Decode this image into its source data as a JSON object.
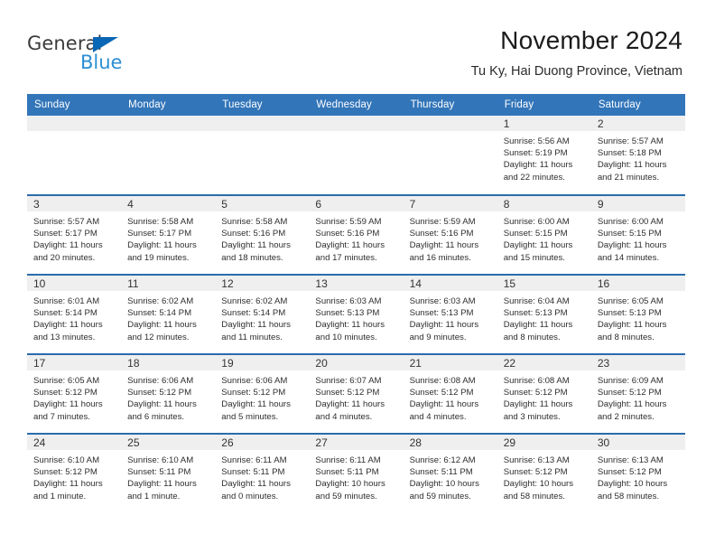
{
  "brand": {
    "name_part1": "General",
    "name_part2": "Blue",
    "accent_color": "#2b8fd4",
    "triangle_color": "#0a67b5"
  },
  "header": {
    "title": "November 2024",
    "subtitle": "Tu Ky, Hai Duong Province, Vietnam",
    "header_bg_color": "#3275b9",
    "row_divider_color": "#2b6cad",
    "daynum_band_color": "#efefef"
  },
  "weekday_headers": [
    "Sunday",
    "Monday",
    "Tuesday",
    "Wednesday",
    "Thursday",
    "Friday",
    "Saturday"
  ],
  "weeks": [
    [
      {
        "day": "",
        "sunrise": "",
        "sunset": "",
        "daylight_1": "",
        "daylight_2": ""
      },
      {
        "day": "",
        "sunrise": "",
        "sunset": "",
        "daylight_1": "",
        "daylight_2": ""
      },
      {
        "day": "",
        "sunrise": "",
        "sunset": "",
        "daylight_1": "",
        "daylight_2": ""
      },
      {
        "day": "",
        "sunrise": "",
        "sunset": "",
        "daylight_1": "",
        "daylight_2": ""
      },
      {
        "day": "",
        "sunrise": "",
        "sunset": "",
        "daylight_1": "",
        "daylight_2": ""
      },
      {
        "day": "1",
        "sunrise": "Sunrise: 5:56 AM",
        "sunset": "Sunset: 5:19 PM",
        "daylight_1": "Daylight: 11 hours",
        "daylight_2": "and 22 minutes."
      },
      {
        "day": "2",
        "sunrise": "Sunrise: 5:57 AM",
        "sunset": "Sunset: 5:18 PM",
        "daylight_1": "Daylight: 11 hours",
        "daylight_2": "and 21 minutes."
      }
    ],
    [
      {
        "day": "3",
        "sunrise": "Sunrise: 5:57 AM",
        "sunset": "Sunset: 5:17 PM",
        "daylight_1": "Daylight: 11 hours",
        "daylight_2": "and 20 minutes."
      },
      {
        "day": "4",
        "sunrise": "Sunrise: 5:58 AM",
        "sunset": "Sunset: 5:17 PM",
        "daylight_1": "Daylight: 11 hours",
        "daylight_2": "and 19 minutes."
      },
      {
        "day": "5",
        "sunrise": "Sunrise: 5:58 AM",
        "sunset": "Sunset: 5:16 PM",
        "daylight_1": "Daylight: 11 hours",
        "daylight_2": "and 18 minutes."
      },
      {
        "day": "6",
        "sunrise": "Sunrise: 5:59 AM",
        "sunset": "Sunset: 5:16 PM",
        "daylight_1": "Daylight: 11 hours",
        "daylight_2": "and 17 minutes."
      },
      {
        "day": "7",
        "sunrise": "Sunrise: 5:59 AM",
        "sunset": "Sunset: 5:16 PM",
        "daylight_1": "Daylight: 11 hours",
        "daylight_2": "and 16 minutes."
      },
      {
        "day": "8",
        "sunrise": "Sunrise: 6:00 AM",
        "sunset": "Sunset: 5:15 PM",
        "daylight_1": "Daylight: 11 hours",
        "daylight_2": "and 15 minutes."
      },
      {
        "day": "9",
        "sunrise": "Sunrise: 6:00 AM",
        "sunset": "Sunset: 5:15 PM",
        "daylight_1": "Daylight: 11 hours",
        "daylight_2": "and 14 minutes."
      }
    ],
    [
      {
        "day": "10",
        "sunrise": "Sunrise: 6:01 AM",
        "sunset": "Sunset: 5:14 PM",
        "daylight_1": "Daylight: 11 hours",
        "daylight_2": "and 13 minutes."
      },
      {
        "day": "11",
        "sunrise": "Sunrise: 6:02 AM",
        "sunset": "Sunset: 5:14 PM",
        "daylight_1": "Daylight: 11 hours",
        "daylight_2": "and 12 minutes."
      },
      {
        "day": "12",
        "sunrise": "Sunrise: 6:02 AM",
        "sunset": "Sunset: 5:14 PM",
        "daylight_1": "Daylight: 11 hours",
        "daylight_2": "and 11 minutes."
      },
      {
        "day": "13",
        "sunrise": "Sunrise: 6:03 AM",
        "sunset": "Sunset: 5:13 PM",
        "daylight_1": "Daylight: 11 hours",
        "daylight_2": "and 10 minutes."
      },
      {
        "day": "14",
        "sunrise": "Sunrise: 6:03 AM",
        "sunset": "Sunset: 5:13 PM",
        "daylight_1": "Daylight: 11 hours",
        "daylight_2": "and 9 minutes."
      },
      {
        "day": "15",
        "sunrise": "Sunrise: 6:04 AM",
        "sunset": "Sunset: 5:13 PM",
        "daylight_1": "Daylight: 11 hours",
        "daylight_2": "and 8 minutes."
      },
      {
        "day": "16",
        "sunrise": "Sunrise: 6:05 AM",
        "sunset": "Sunset: 5:13 PM",
        "daylight_1": "Daylight: 11 hours",
        "daylight_2": "and 8 minutes."
      }
    ],
    [
      {
        "day": "17",
        "sunrise": "Sunrise: 6:05 AM",
        "sunset": "Sunset: 5:12 PM",
        "daylight_1": "Daylight: 11 hours",
        "daylight_2": "and 7 minutes."
      },
      {
        "day": "18",
        "sunrise": "Sunrise: 6:06 AM",
        "sunset": "Sunset: 5:12 PM",
        "daylight_1": "Daylight: 11 hours",
        "daylight_2": "and 6 minutes."
      },
      {
        "day": "19",
        "sunrise": "Sunrise: 6:06 AM",
        "sunset": "Sunset: 5:12 PM",
        "daylight_1": "Daylight: 11 hours",
        "daylight_2": "and 5 minutes."
      },
      {
        "day": "20",
        "sunrise": "Sunrise: 6:07 AM",
        "sunset": "Sunset: 5:12 PM",
        "daylight_1": "Daylight: 11 hours",
        "daylight_2": "and 4 minutes."
      },
      {
        "day": "21",
        "sunrise": "Sunrise: 6:08 AM",
        "sunset": "Sunset: 5:12 PM",
        "daylight_1": "Daylight: 11 hours",
        "daylight_2": "and 4 minutes."
      },
      {
        "day": "22",
        "sunrise": "Sunrise: 6:08 AM",
        "sunset": "Sunset: 5:12 PM",
        "daylight_1": "Daylight: 11 hours",
        "daylight_2": "and 3 minutes."
      },
      {
        "day": "23",
        "sunrise": "Sunrise: 6:09 AM",
        "sunset": "Sunset: 5:12 PM",
        "daylight_1": "Daylight: 11 hours",
        "daylight_2": "and 2 minutes."
      }
    ],
    [
      {
        "day": "24",
        "sunrise": "Sunrise: 6:10 AM",
        "sunset": "Sunset: 5:12 PM",
        "daylight_1": "Daylight: 11 hours",
        "daylight_2": "and 1 minute."
      },
      {
        "day": "25",
        "sunrise": "Sunrise: 6:10 AM",
        "sunset": "Sunset: 5:11 PM",
        "daylight_1": "Daylight: 11 hours",
        "daylight_2": "and 1 minute."
      },
      {
        "day": "26",
        "sunrise": "Sunrise: 6:11 AM",
        "sunset": "Sunset: 5:11 PM",
        "daylight_1": "Daylight: 11 hours",
        "daylight_2": "and 0 minutes."
      },
      {
        "day": "27",
        "sunrise": "Sunrise: 6:11 AM",
        "sunset": "Sunset: 5:11 PM",
        "daylight_1": "Daylight: 10 hours",
        "daylight_2": "and 59 minutes."
      },
      {
        "day": "28",
        "sunrise": "Sunrise: 6:12 AM",
        "sunset": "Sunset: 5:11 PM",
        "daylight_1": "Daylight: 10 hours",
        "daylight_2": "and 59 minutes."
      },
      {
        "day": "29",
        "sunrise": "Sunrise: 6:13 AM",
        "sunset": "Sunset: 5:12 PM",
        "daylight_1": "Daylight: 10 hours",
        "daylight_2": "and 58 minutes."
      },
      {
        "day": "30",
        "sunrise": "Sunrise: 6:13 AM",
        "sunset": "Sunset: 5:12 PM",
        "daylight_1": "Daylight: 10 hours",
        "daylight_2": "and 58 minutes."
      }
    ]
  ]
}
